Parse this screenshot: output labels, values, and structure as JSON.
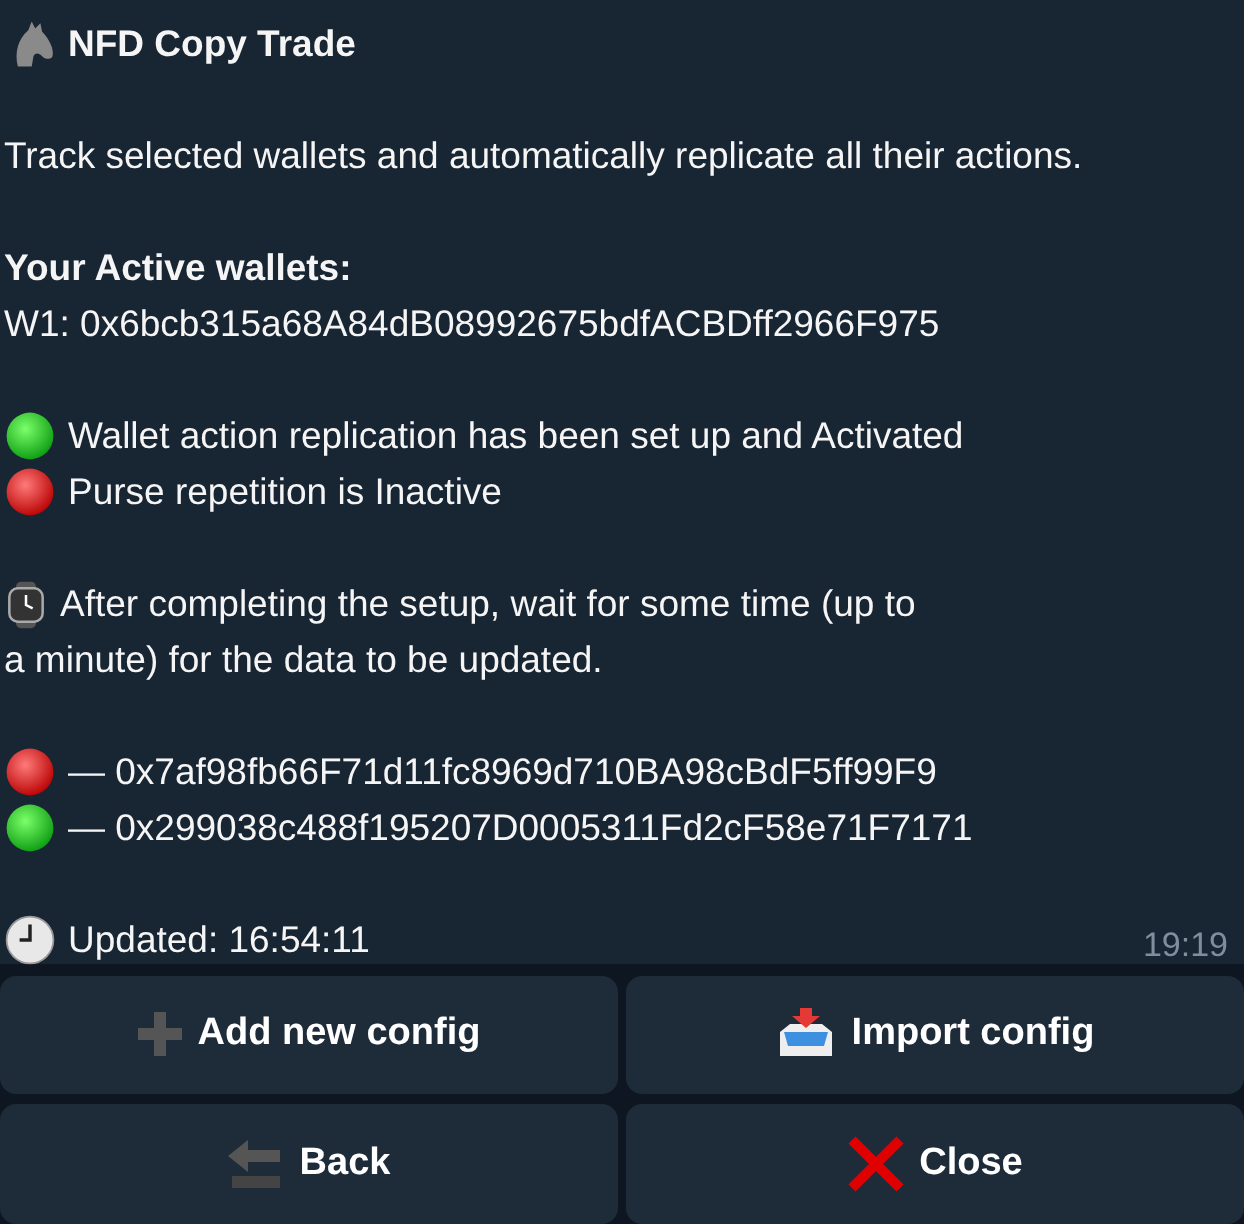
{
  "message": {
    "title": "NFD Copy Trade",
    "intro": "Track selected wallets and automatically replicate all their actions.",
    "wallets_heading": "Your Active wallets:",
    "wallets": [
      "W1: 0x6bcb315a68A84dB08992675bdfACBDff2966F975"
    ],
    "statuses": [
      {
        "text": "Wallet action replication has been set up and Activated",
        "active": true
      },
      {
        "text": "Purse repetition is Inactive",
        "active": false
      }
    ],
    "note_lines": [
      "After completing the setup, wait for some time (up to",
      "a minute) for the data to be updated."
    ],
    "addresses": [
      {
        "text": "— 0x7af98fb66F71d11fc8969d710BA98cBdF5ff99F9",
        "active": false
      },
      {
        "text": "— 0x299038c488f195207D0005311Fd2cF58e71F7171",
        "active": true
      }
    ],
    "updated": "Updated: 16:54:11",
    "time": "19:19"
  },
  "buttons": [
    {
      "label": "Add new config",
      "kind": "add"
    },
    {
      "label": "Import config",
      "kind": "import"
    },
    {
      "label": "Back",
      "kind": "back"
    },
    {
      "label": "Close",
      "kind": "close"
    }
  ]
}
